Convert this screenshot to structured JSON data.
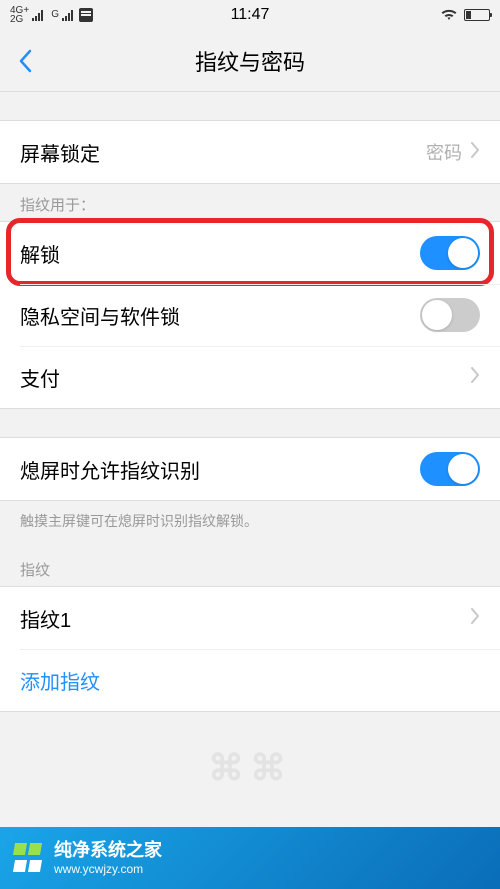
{
  "status": {
    "net1": "4G+",
    "net2": "2G",
    "net_sim2": "G",
    "time": "11:47"
  },
  "header": {
    "title": "指纹与密码"
  },
  "screen_lock": {
    "label": "屏幕锁定",
    "value": "密码"
  },
  "fingerprint_usage": {
    "header": "指纹用于：",
    "unlock": {
      "label": "解锁",
      "on": true
    },
    "privacy": {
      "label": "隐私空间与软件锁",
      "on": false
    },
    "payment": {
      "label": "支付"
    }
  },
  "off_screen": {
    "label": "熄屏时允许指纹识别",
    "on": true,
    "desc": "触摸主屏键可在熄屏时识别指纹解锁。"
  },
  "fingerprints": {
    "header": "指纹",
    "item1": "指纹1",
    "add": "添加指纹"
  },
  "watermark": "⌘⌘",
  "footer": {
    "title": "纯净系统之家",
    "url": "www.ycwjzy.com"
  }
}
